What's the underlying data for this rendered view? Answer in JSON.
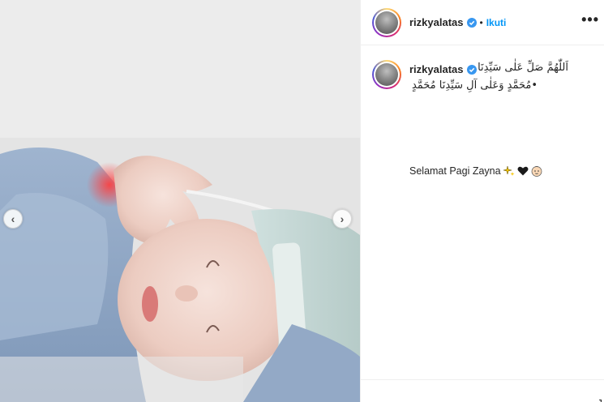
{
  "post": {
    "photo_alt": "",
    "nav_prev_label": "‹",
    "nav_next_label": "›"
  },
  "header": {
    "username": "rizkyalatas",
    "separator": "•",
    "follow_label": "Ikuti",
    "more_label": "•••"
  },
  "caption": {
    "username": "rizkyalatas",
    "arabic_line1": "اَللّٰهُمَّ صَلِّ عَلٰى سَيِّدِنَا",
    "arabic_line2": "•مُحَمَّدٍ وَعَلٰى آلِ سَيِّدِنَا مُحَمَّدٍ",
    "greeting": "Selamat Pagi Zayna"
  },
  "footer": {
    "cutoff_char": "J"
  },
  "colors": {
    "follow_blue": "#0095f6",
    "verified_blue": "#3897f0",
    "divider": "#efefef"
  },
  "icons": [
    "verified-badge-icon",
    "chevron-left-icon",
    "chevron-right-icon",
    "more-options-icon",
    "sparkles-emoji-icon",
    "black-heart-emoji-icon",
    "baby-emoji-icon"
  ]
}
